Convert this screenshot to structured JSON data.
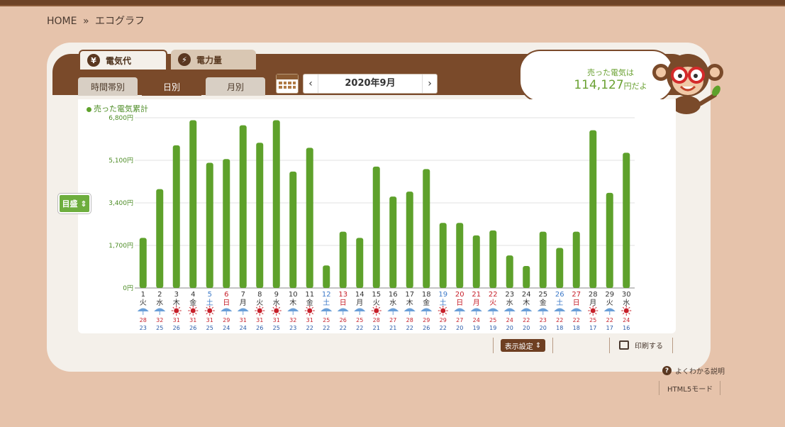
{
  "breadcrumb": {
    "home": "HOME",
    "sep": "»",
    "current": "エコグラフ"
  },
  "main_tabs": [
    {
      "label": "電気代",
      "icon": "yen-icon",
      "active": true
    },
    {
      "label": "電力量",
      "icon": "lightning-icon",
      "active": false
    }
  ],
  "sub_tabs": [
    {
      "label": "時間帯別",
      "active": false
    },
    {
      "label": "日別",
      "active": true
    },
    {
      "label": "月別",
      "active": false
    }
  ],
  "month": {
    "label": "2020年9月",
    "prev": "‹",
    "next": "›"
  },
  "bubble": {
    "line1": "売った電気は",
    "amount": "114,127",
    "suffix": "円だよ"
  },
  "legend": "売った電気累計",
  "scale_button": "目盛",
  "controls": {
    "display_settings": "表示設定",
    "print": "印刷する"
  },
  "help_link": "よくわかる説明",
  "html5_mode": "HTML5モード",
  "colors": {
    "bar": "#5ea12b",
    "weekday": "#333333",
    "saturday": "#3c79c8",
    "sunday_holiday": "#c7202a",
    "high_temp": "#c7202a",
    "low_temp": "#2a5aa8"
  },
  "chart_data": {
    "type": "bar",
    "ylim": [
      0,
      6800
    ],
    "yticks": [
      "0円",
      "1,700円",
      "3,400円",
      "5,100円",
      "6,800円"
    ],
    "days": [
      "1",
      "2",
      "3",
      "4",
      "5",
      "6",
      "7",
      "8",
      "9",
      "10",
      "11",
      "12",
      "13",
      "14",
      "15",
      "16",
      "17",
      "18",
      "19",
      "20",
      "21",
      "22",
      "23",
      "24",
      "25",
      "26",
      "27",
      "28",
      "29",
      "30"
    ],
    "weekdays": [
      "火",
      "水",
      "木",
      "金",
      "土",
      "日",
      "月",
      "火",
      "水",
      "木",
      "金",
      "土",
      "日",
      "月",
      "火",
      "水",
      "木",
      "金",
      "土",
      "日",
      "月",
      "火",
      "水",
      "木",
      "金",
      "土",
      "日",
      "月",
      "火",
      "水"
    ],
    "day_type": [
      "w",
      "w",
      "w",
      "w",
      "sat",
      "sun",
      "w",
      "w",
      "w",
      "w",
      "w",
      "sat",
      "sun",
      "w",
      "w",
      "w",
      "w",
      "w",
      "sat",
      "sun",
      "hol",
      "hol",
      "w",
      "w",
      "w",
      "sat",
      "sun",
      "w",
      "w",
      "w"
    ],
    "values": [
      2000,
      3950,
      5700,
      6700,
      5000,
      5150,
      6500,
      5800,
      6700,
      4650,
      5600,
      900,
      2250,
      2000,
      4850,
      3650,
      3850,
      4750,
      2600,
      2600,
      2100,
      2300,
      1300,
      880,
      2250,
      1600,
      2250,
      6300,
      3800,
      5400
    ],
    "weather": [
      "rain",
      "rain",
      "sun",
      "sun",
      "sun",
      "rain",
      "rain",
      "sun",
      "sun",
      "rain",
      "sun",
      "rain",
      "rain",
      "rain",
      "sun",
      "rain",
      "rain",
      "rain",
      "sun",
      "rain",
      "rain",
      "rain",
      "rain",
      "rain",
      "rain",
      "rain",
      "rain",
      "sun",
      "rain",
      "sun"
    ],
    "high_temps": [
      "28",
      "32",
      "31",
      "31",
      "31",
      "29",
      "31",
      "31",
      "31",
      "32",
      "31",
      "25",
      "26",
      "25",
      "28",
      "27",
      "28",
      "29",
      "29",
      "27",
      "24",
      "25",
      "24",
      "22",
      "23",
      "22",
      "22",
      "25",
      "22",
      "24"
    ],
    "low_temps": [
      "23",
      "25",
      "26",
      "26",
      "25",
      "24",
      "24",
      "26",
      "25",
      "23",
      "22",
      "22",
      "22",
      "22",
      "21",
      "21",
      "22",
      "26",
      "22",
      "20",
      "19",
      "19",
      "20",
      "20",
      "20",
      "18",
      "18",
      "17",
      "17",
      "16"
    ]
  }
}
